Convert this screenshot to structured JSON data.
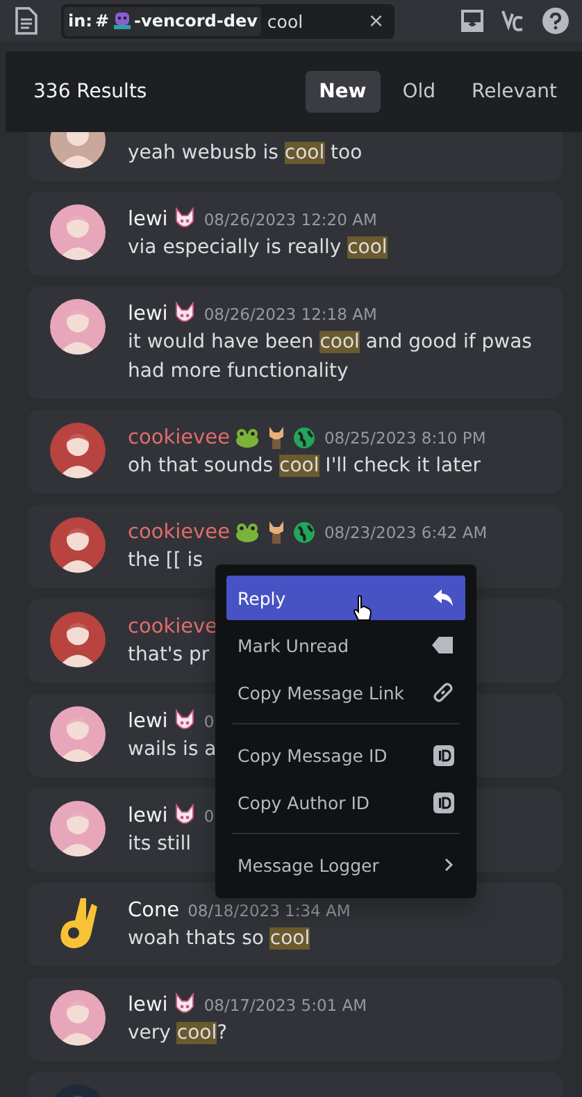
{
  "search": {
    "filter_prefix": "in:",
    "channel": "#",
    "channel_name": "-vencord-dev",
    "query": "cool",
    "clear": "×"
  },
  "results": {
    "count": "336 Results",
    "tabs": [
      {
        "label": "New",
        "selected": true
      },
      {
        "label": "Old",
        "selected": false
      },
      {
        "label": "Relevant",
        "selected": false
      }
    ]
  },
  "messages": [
    {
      "kind": "cut",
      "parts": [
        {
          "text": "yeah webusb is ",
          "match": false
        },
        {
          "text": "cool",
          "match": true
        },
        {
          "text": " too",
          "match": false
        }
      ]
    },
    {
      "kind": "full",
      "author": "lewi",
      "color": "#f2f3f5",
      "badges": [
        {
          "kind": "mask"
        }
      ],
      "time": "08/26/2023 12:20 AM",
      "parts": [
        {
          "text": "via especially is really ",
          "match": false
        },
        {
          "text": "cool",
          "match": true
        }
      ]
    },
    {
      "kind": "full",
      "author": "lewi",
      "color": "#f2f3f5",
      "badges": [
        {
          "kind": "mask"
        }
      ],
      "time": "08/26/2023 12:18 AM",
      "parts": [
        {
          "text": "it would have been ",
          "match": false
        },
        {
          "text": "cool",
          "match": true
        },
        {
          "text": " and good if pwas had more functionality",
          "match": false
        }
      ]
    },
    {
      "kind": "full",
      "author": "cookievee",
      "color": "#e06c6c",
      "badges": [
        {
          "kind": "frog"
        },
        {
          "kind": "fox"
        },
        {
          "kind": "globe"
        }
      ],
      "time": "08/25/2023 8:10 PM",
      "parts": [
        {
          "text": "oh that sounds ",
          "match": false
        },
        {
          "text": "cool",
          "match": true
        },
        {
          "text": " I'll check it later",
          "match": false
        }
      ]
    },
    {
      "kind": "full",
      "author": "cookievee",
      "color": "#e06c6c",
      "badges": [
        {
          "kind": "frog"
        },
        {
          "kind": "fox"
        },
        {
          "kind": "globe"
        }
      ],
      "time": "08/23/2023 6:42 AM",
      "parts": [
        {
          "text": "the [[ is",
          "match": false
        }
      ]
    },
    {
      "kind": "full",
      "author": "cookieve",
      "color": "#e06c6c",
      "parts": [
        {
          "text": "that's pr",
          "match": false
        }
      ]
    },
    {
      "kind": "full",
      "author": "lewi",
      "color": "#f2f3f5",
      "badges": [
        {
          "kind": "mask"
        }
      ],
      "time": "0",
      "parts": [
        {
          "text": "wails is a",
          "match": false
        }
      ]
    },
    {
      "kind": "full",
      "author": "lewi",
      "color": "#f2f3f5",
      "badges": [
        {
          "kind": "mask"
        }
      ],
      "time": "0",
      "parts": [
        {
          "text": "its still",
          "match": false
        }
      ]
    },
    {
      "kind": "emoji",
      "author": "Cone",
      "color": "#f2f3f5",
      "time": "08/18/2023 1:34 AM",
      "parts": [
        {
          "text": "woah thats so ",
          "match": false
        },
        {
          "text": "cool",
          "match": true
        }
      ]
    },
    {
      "kind": "full",
      "author": "lewi",
      "color": "#f2f3f5",
      "badges": [
        {
          "kind": "mask"
        }
      ],
      "time": "08/17/2023 5:01 AM",
      "parts": [
        {
          "text": "very ",
          "match": false
        },
        {
          "text": "cool",
          "match": true
        },
        {
          "text": "?",
          "match": false
        }
      ]
    },
    {
      "kind": "empty"
    }
  ],
  "context_menu": {
    "items": [
      {
        "kind": "reply",
        "label": "Reply",
        "selected": true
      },
      {
        "kind": "unread",
        "label": "Mark Unread",
        "selected": false
      },
      {
        "kind": "link",
        "label": "Copy Message Link",
        "selected": false
      },
      {
        "kind": "divider"
      },
      {
        "kind": "id",
        "label": "Copy Message ID",
        "selected": false
      },
      {
        "kind": "id",
        "label": "Copy Author ID",
        "selected": false
      },
      {
        "kind": "divider"
      },
      {
        "kind": "submenu",
        "label": "Message Logger",
        "selected": false
      }
    ]
  }
}
